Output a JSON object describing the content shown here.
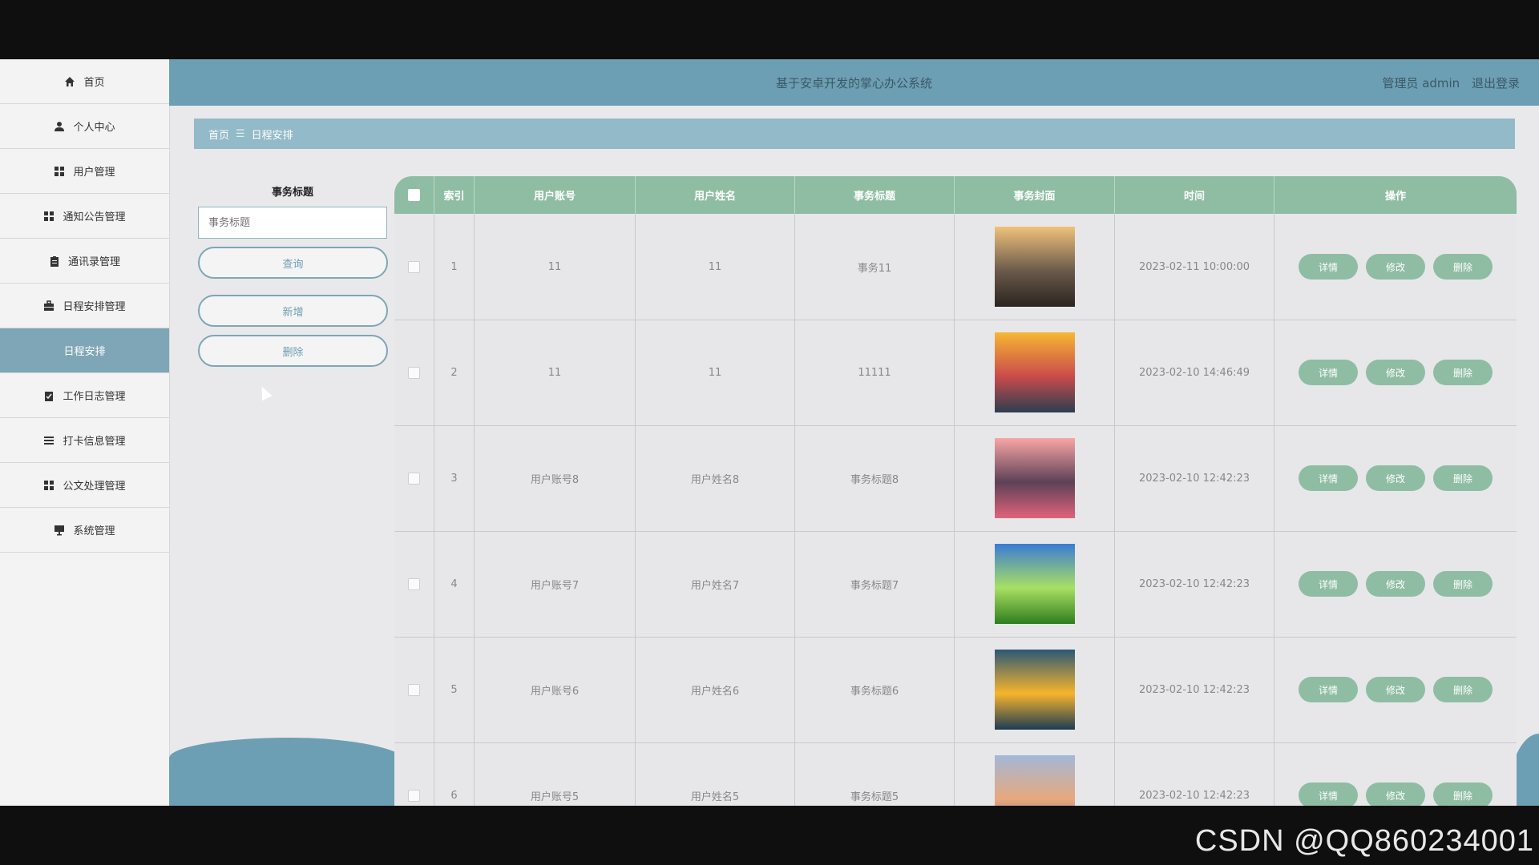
{
  "sidebar": {
    "items": [
      {
        "label": "首页",
        "icon": "home-icon"
      },
      {
        "label": "个人中心",
        "icon": "user-icon"
      },
      {
        "label": "用户管理",
        "icon": "grid-icon"
      },
      {
        "label": "通知公告管理",
        "icon": "grid-icon"
      },
      {
        "label": "通讯录管理",
        "icon": "clipboard-icon"
      },
      {
        "label": "日程安排管理",
        "icon": "briefcase-icon"
      },
      {
        "label": "日程安排",
        "icon": ""
      },
      {
        "label": "工作日志管理",
        "icon": "checklist-icon"
      },
      {
        "label": "打卡信息管理",
        "icon": "list-icon"
      },
      {
        "label": "公文处理管理",
        "icon": "grid-icon"
      },
      {
        "label": "系统管理",
        "icon": "monitor-icon"
      }
    ]
  },
  "header": {
    "title": "基于安卓开发的掌心办公系统",
    "user": "管理员 admin",
    "logout": "退出登录"
  },
  "breadcrumb": {
    "home": "首页",
    "current": "日程安排"
  },
  "search": {
    "label": "事务标题",
    "placeholder": "事务标题",
    "query_label": "查询",
    "add_label": "新增",
    "delete_label": "删除"
  },
  "table": {
    "columns": [
      "索引",
      "用户账号",
      "用户姓名",
      "事务标题",
      "事务封面",
      "时间",
      "操作"
    ],
    "actions": {
      "detail": "详情",
      "edit": "修改",
      "delete": "删除"
    },
    "rows": [
      {
        "index": "1",
        "account": "11",
        "name": "11",
        "title": "事务11",
        "time": "2023-02-11 10:00:00",
        "cover": "lake-tree"
      },
      {
        "index": "2",
        "account": "11",
        "name": "11",
        "title": "11111",
        "time": "2023-02-10 14:46:49",
        "cover": "sunset-boat"
      },
      {
        "index": "3",
        "account": "用户账号8",
        "name": "用户姓名8",
        "title": "事务标题8",
        "time": "2023-02-10 12:42:23",
        "cover": "mountain-lake"
      },
      {
        "index": "4",
        "account": "用户账号7",
        "name": "用户姓名7",
        "title": "事务标题7",
        "time": "2023-02-10 12:42:23",
        "cover": "green-field"
      },
      {
        "index": "5",
        "account": "用户账号6",
        "name": "用户姓名6",
        "title": "事务标题6",
        "time": "2023-02-10 12:42:23",
        "cover": "golden-reflection"
      },
      {
        "index": "6",
        "account": "用户账号5",
        "name": "用户姓名5",
        "title": "事务标题5",
        "time": "2023-02-10 12:42:23",
        "cover": "pier-sunset"
      }
    ]
  },
  "watermark": "CSDN @QQ860234001"
}
